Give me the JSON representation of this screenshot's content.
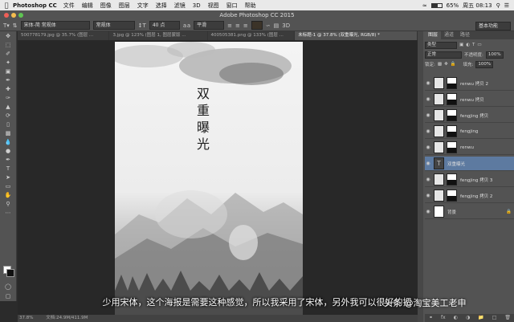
{
  "menubar": {
    "app_name": "Photoshop CC",
    "items": [
      "文件",
      "编辑",
      "图像",
      "图层",
      "文字",
      "选择",
      "滤镜",
      "3D",
      "视图",
      "窗口",
      "帮助"
    ],
    "battery_percent": 65,
    "battery_text": "65%",
    "time": "周五 08:13"
  },
  "window": {
    "title": "Adobe Photoshop CC 2015"
  },
  "options_bar": {
    "font_family": "宋体-简 常规体",
    "font_style": "常规体",
    "font_size": "40 点",
    "aa_method": "平滑",
    "workspace": "基本功能"
  },
  "tabs": [
    {
      "label": "500778179.jpg @ 35.7% (图层 ...",
      "active": false
    },
    {
      "label": "3.jpg @ 123% (图层 1, 图层蒙版 ...",
      "active": false
    },
    {
      "label": "400505381.png @ 133% (图层 ...",
      "active": false
    },
    {
      "label": "未标题-1 @ 37.8% (双重曝光, RGB/8) *",
      "active": true
    }
  ],
  "poster": {
    "title": "双重曝光"
  },
  "status": {
    "zoom": "37.8%",
    "doc_size": "文档:24.9M/411.9M"
  },
  "panels": {
    "tabs": [
      "图层",
      "通道",
      "路径"
    ],
    "kind_filter": "类型",
    "blend_mode": "正常",
    "opacity_label": "不透明度:",
    "opacity_value": "100%",
    "lock_label": "锁定:",
    "fill_label": "填充:",
    "fill_value": "100%"
  },
  "layers": [
    {
      "name": "renwu 拷贝 2",
      "type": "masked",
      "selected": false
    },
    {
      "name": "renwu 拷贝",
      "type": "masked",
      "selected": false
    },
    {
      "name": "fengjing 拷贝",
      "type": "masked",
      "selected": false
    },
    {
      "name": "fengjing",
      "type": "masked",
      "selected": false
    },
    {
      "name": "renwu",
      "type": "masked",
      "selected": false
    },
    {
      "name": "双重曝光",
      "type": "text",
      "selected": true
    },
    {
      "name": "fengjing 拷贝 3",
      "type": "masked",
      "selected": false
    },
    {
      "name": "fengjing 拷贝 2",
      "type": "masked",
      "selected": false
    },
    {
      "name": "背景",
      "type": "plain",
      "selected": false
    }
  ],
  "subtitle": "少用宋体，这个海报是需要这种感觉，所以我采用了宋体，另外我可以很好的把",
  "watermark": "头条 @淘宝美工老申"
}
